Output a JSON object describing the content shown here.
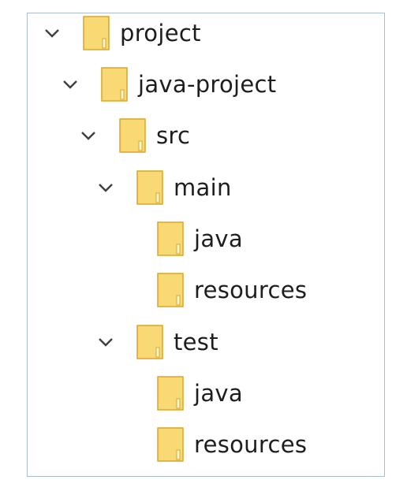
{
  "tree": {
    "root": {
      "label": "project",
      "expanded": true,
      "icon": "folder-icon"
    },
    "java_project": {
      "label": "java-project",
      "expanded": true,
      "icon": "folder-icon"
    },
    "src": {
      "label": "src",
      "expanded": true,
      "icon": "folder-icon"
    },
    "main": {
      "label": "main",
      "expanded": true,
      "icon": "folder-icon"
    },
    "main_java": {
      "label": "java",
      "icon": "folder-icon"
    },
    "main_resources": {
      "label": "resources",
      "icon": "folder-icon"
    },
    "test": {
      "label": "test",
      "expanded": true,
      "icon": "folder-icon"
    },
    "test_java": {
      "label": "java",
      "icon": "folder-icon"
    },
    "test_resources": {
      "label": "resources",
      "icon": "folder-icon"
    }
  },
  "colors": {
    "border": "#a9bdd6",
    "folder_fill": "#f9d974",
    "folder_edge": "#d9a628",
    "chevron": "#404040",
    "text": "#1e1e1e"
  }
}
